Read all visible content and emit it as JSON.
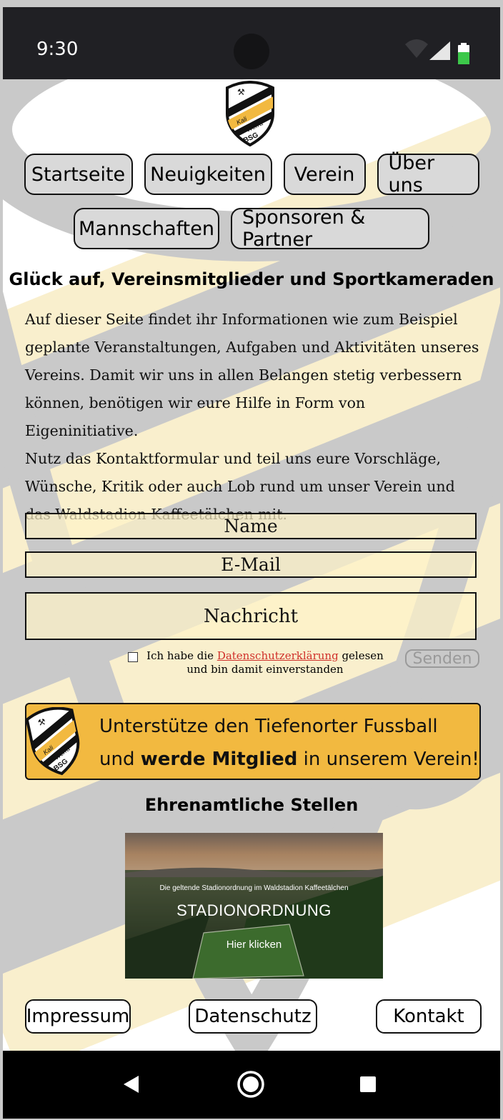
{
  "status_bar": {
    "time": "9:30"
  },
  "nav": {
    "row1": [
      "Startseite",
      "Neuigkeiten",
      "Verein",
      "Über uns"
    ],
    "row2": [
      "Mannschaften",
      "Sponsoren & Partner"
    ]
  },
  "heading": "Glück auf, Vereinsmitglieder und Sportkameraden",
  "intro_lines": [
    "Auf dieser Seite findet ihr Informationen wie zum Beispiel",
    "geplante Veranstaltungen, Aufgaben und Aktivitäten unseres",
    "Vereins. Damit wir uns in allen Belangen stetig verbessern",
    "können, benötigen wir eure Hilfe in Form von Eigeninitiative.",
    "Nutz das Kontaktformular und teil uns eure Vorschläge,",
    "Wünsche, Kritik oder auch Lob rund um unser Verein und",
    "das Waldstadion Kaffeetälchen mit."
  ],
  "form": {
    "name_placeholder": "Name",
    "email_placeholder": "E-Mail",
    "message_placeholder": "Nachricht",
    "consent_before": "Ich habe die ",
    "consent_link": "Datenschutzerklärung",
    "consent_after": " gelesen",
    "consent_line2": "und bin damit einverstanden",
    "send_label": "Senden"
  },
  "logo": {
    "text_line1": "Kali",
    "text_line2": "Werra",
    "text_line3": "BSG"
  },
  "banner": {
    "line1": "Unterstütze den Tiefenorter Fussball",
    "line2_pre": "und ",
    "line2_bold": "werde Mitglied",
    "line2_post": " in unserem Verein!"
  },
  "section_title": "Ehrenamtliche Stellen",
  "promo": {
    "subtitle": "Die geltende Stadionordnung im Waldstadion Kaffeetälchen",
    "title": "STADIONORDNUNG",
    "cta": "Hier klicken"
  },
  "footer": [
    "Impressum",
    "Datenschutz",
    "Kontakt"
  ],
  "colors": {
    "status_bar_bg": "#202024",
    "banner_bg": "#f2b940",
    "link_red": "#d0302a",
    "field_bg": "#fff4c8",
    "nav_btn_bg": "#d9d9d9"
  },
  "icons": [
    "wifi-icon",
    "signal-icon",
    "battery-icon",
    "back-icon",
    "home-icon",
    "recents-icon"
  ]
}
